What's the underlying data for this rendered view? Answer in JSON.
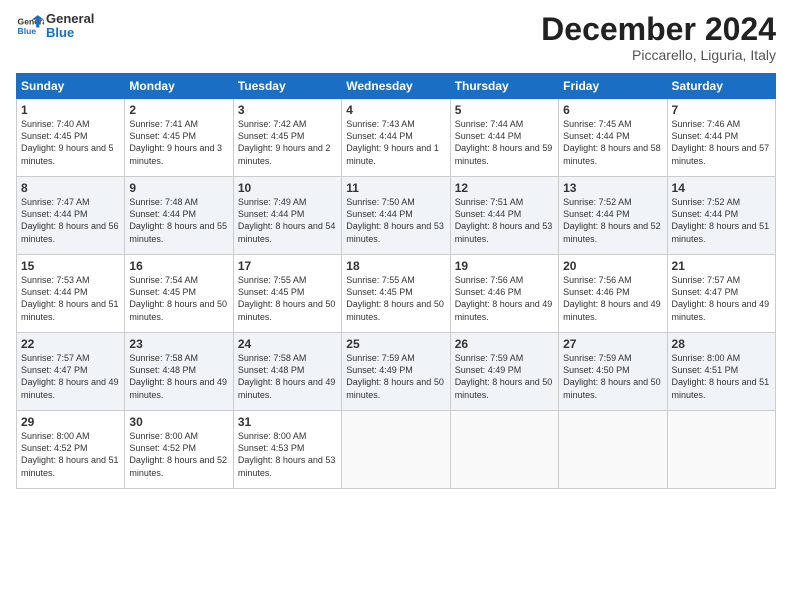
{
  "header": {
    "logo_line1": "General",
    "logo_line2": "Blue",
    "month": "December 2024",
    "location": "Piccarello, Liguria, Italy"
  },
  "days_of_week": [
    "Sunday",
    "Monday",
    "Tuesday",
    "Wednesday",
    "Thursday",
    "Friday",
    "Saturday"
  ],
  "weeks": [
    [
      {
        "day": "1",
        "info": "Sunrise: 7:40 AM\nSunset: 4:45 PM\nDaylight: 9 hours and 5 minutes."
      },
      {
        "day": "2",
        "info": "Sunrise: 7:41 AM\nSunset: 4:45 PM\nDaylight: 9 hours and 3 minutes."
      },
      {
        "day": "3",
        "info": "Sunrise: 7:42 AM\nSunset: 4:45 PM\nDaylight: 9 hours and 2 minutes."
      },
      {
        "day": "4",
        "info": "Sunrise: 7:43 AM\nSunset: 4:44 PM\nDaylight: 9 hours and 1 minute."
      },
      {
        "day": "5",
        "info": "Sunrise: 7:44 AM\nSunset: 4:44 PM\nDaylight: 8 hours and 59 minutes."
      },
      {
        "day": "6",
        "info": "Sunrise: 7:45 AM\nSunset: 4:44 PM\nDaylight: 8 hours and 58 minutes."
      },
      {
        "day": "7",
        "info": "Sunrise: 7:46 AM\nSunset: 4:44 PM\nDaylight: 8 hours and 57 minutes."
      }
    ],
    [
      {
        "day": "8",
        "info": "Sunrise: 7:47 AM\nSunset: 4:44 PM\nDaylight: 8 hours and 56 minutes."
      },
      {
        "day": "9",
        "info": "Sunrise: 7:48 AM\nSunset: 4:44 PM\nDaylight: 8 hours and 55 minutes."
      },
      {
        "day": "10",
        "info": "Sunrise: 7:49 AM\nSunset: 4:44 PM\nDaylight: 8 hours and 54 minutes."
      },
      {
        "day": "11",
        "info": "Sunrise: 7:50 AM\nSunset: 4:44 PM\nDaylight: 8 hours and 53 minutes."
      },
      {
        "day": "12",
        "info": "Sunrise: 7:51 AM\nSunset: 4:44 PM\nDaylight: 8 hours and 53 minutes."
      },
      {
        "day": "13",
        "info": "Sunrise: 7:52 AM\nSunset: 4:44 PM\nDaylight: 8 hours and 52 minutes."
      },
      {
        "day": "14",
        "info": "Sunrise: 7:52 AM\nSunset: 4:44 PM\nDaylight: 8 hours and 51 minutes."
      }
    ],
    [
      {
        "day": "15",
        "info": "Sunrise: 7:53 AM\nSunset: 4:44 PM\nDaylight: 8 hours and 51 minutes."
      },
      {
        "day": "16",
        "info": "Sunrise: 7:54 AM\nSunset: 4:45 PM\nDaylight: 8 hours and 50 minutes."
      },
      {
        "day": "17",
        "info": "Sunrise: 7:55 AM\nSunset: 4:45 PM\nDaylight: 8 hours and 50 minutes."
      },
      {
        "day": "18",
        "info": "Sunrise: 7:55 AM\nSunset: 4:45 PM\nDaylight: 8 hours and 50 minutes."
      },
      {
        "day": "19",
        "info": "Sunrise: 7:56 AM\nSunset: 4:46 PM\nDaylight: 8 hours and 49 minutes."
      },
      {
        "day": "20",
        "info": "Sunrise: 7:56 AM\nSunset: 4:46 PM\nDaylight: 8 hours and 49 minutes."
      },
      {
        "day": "21",
        "info": "Sunrise: 7:57 AM\nSunset: 4:47 PM\nDaylight: 8 hours and 49 minutes."
      }
    ],
    [
      {
        "day": "22",
        "info": "Sunrise: 7:57 AM\nSunset: 4:47 PM\nDaylight: 8 hours and 49 minutes."
      },
      {
        "day": "23",
        "info": "Sunrise: 7:58 AM\nSunset: 4:48 PM\nDaylight: 8 hours and 49 minutes."
      },
      {
        "day": "24",
        "info": "Sunrise: 7:58 AM\nSunset: 4:48 PM\nDaylight: 8 hours and 49 minutes."
      },
      {
        "day": "25",
        "info": "Sunrise: 7:59 AM\nSunset: 4:49 PM\nDaylight: 8 hours and 50 minutes."
      },
      {
        "day": "26",
        "info": "Sunrise: 7:59 AM\nSunset: 4:49 PM\nDaylight: 8 hours and 50 minutes."
      },
      {
        "day": "27",
        "info": "Sunrise: 7:59 AM\nSunset: 4:50 PM\nDaylight: 8 hours and 50 minutes."
      },
      {
        "day": "28",
        "info": "Sunrise: 8:00 AM\nSunset: 4:51 PM\nDaylight: 8 hours and 51 minutes."
      }
    ],
    [
      {
        "day": "29",
        "info": "Sunrise: 8:00 AM\nSunset: 4:52 PM\nDaylight: 8 hours and 51 minutes."
      },
      {
        "day": "30",
        "info": "Sunrise: 8:00 AM\nSunset: 4:52 PM\nDaylight: 8 hours and 52 minutes."
      },
      {
        "day": "31",
        "info": "Sunrise: 8:00 AM\nSunset: 4:53 PM\nDaylight: 8 hours and 53 minutes."
      },
      {
        "day": "",
        "info": ""
      },
      {
        "day": "",
        "info": ""
      },
      {
        "day": "",
        "info": ""
      },
      {
        "day": "",
        "info": ""
      }
    ]
  ]
}
